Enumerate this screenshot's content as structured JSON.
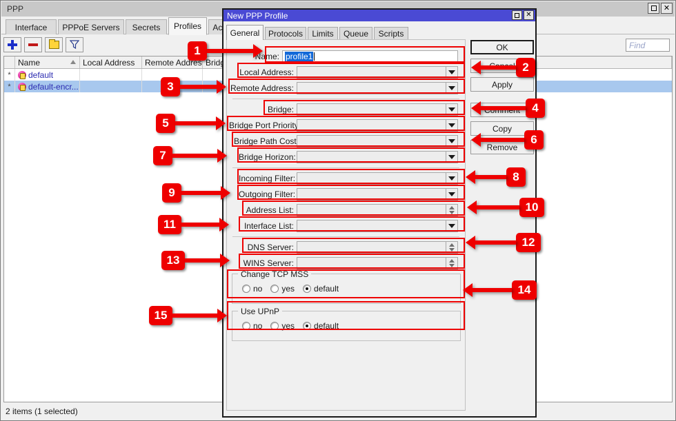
{
  "main_window": {
    "title": "PPP",
    "window_controls": [
      {
        "name": "restore-button",
        "glyph": "□"
      },
      {
        "name": "close-button",
        "glyph": "✕"
      }
    ],
    "tabs": [
      {
        "label": "Interface",
        "active": false
      },
      {
        "label": "PPPoE Servers",
        "active": false
      },
      {
        "label": "Secrets",
        "active": false
      },
      {
        "label": "Profiles",
        "active": true
      },
      {
        "label": "Active Connec",
        "active": false
      }
    ],
    "toolbar": [
      {
        "name": "add-button",
        "icon": "plus-icon"
      },
      {
        "name": "remove-button",
        "icon": "minus-icon"
      },
      {
        "name": "enable-button",
        "icon": "folder-icon"
      },
      {
        "name": "filter-button",
        "icon": "funnel-icon"
      }
    ],
    "find": {
      "placeholder": "Find",
      "value": ""
    },
    "list": {
      "columns": [
        "Name",
        "Local Address",
        "Remote Address",
        "Bridge"
      ],
      "sort_column": "Name",
      "rows": [
        {
          "flag": "*",
          "name": "default",
          "local_address": "",
          "remote_address": "",
          "bridge": "",
          "selected": false
        },
        {
          "flag": "*",
          "name": "default-encr...",
          "local_address": "",
          "remote_address": "",
          "bridge": "",
          "selected": true
        }
      ]
    },
    "status": "2 items (1 selected)"
  },
  "dialog": {
    "title": "New PPP Profile",
    "window_controls": [
      {
        "name": "restore-button",
        "glyph": "□"
      },
      {
        "name": "close-button",
        "glyph": "✕"
      }
    ],
    "tabs": [
      {
        "label": "General",
        "active": true
      },
      {
        "label": "Protocols",
        "active": false
      },
      {
        "label": "Limits",
        "active": false
      },
      {
        "label": "Queue",
        "active": false
      },
      {
        "label": "Scripts",
        "active": false
      }
    ],
    "fields": [
      {
        "label": "Name:",
        "value": "profile1",
        "control": "text",
        "selected": true
      },
      {
        "label": "Local Address:",
        "value": "",
        "control": "dropdown"
      },
      {
        "label": "Remote Address:",
        "value": "",
        "control": "dropdown"
      },
      {
        "label": "Bridge:",
        "value": "",
        "control": "dropdown"
      },
      {
        "label": "Bridge Port Priority:",
        "value": "",
        "control": "dropdown"
      },
      {
        "label": "Bridge Path Cost:",
        "value": "",
        "control": "dropdown"
      },
      {
        "label": "Bridge Horizon:",
        "value": "",
        "control": "dropdown"
      },
      {
        "label": "Incoming Filter:",
        "value": "",
        "control": "dropdown"
      },
      {
        "label": "Outgoing Filter:",
        "value": "",
        "control": "dropdown"
      },
      {
        "label": "Address List:",
        "value": "",
        "control": "spinner"
      },
      {
        "label": "Interface List:",
        "value": "",
        "control": "dropdown"
      },
      {
        "label": "DNS Server:",
        "value": "",
        "control": "spinner"
      },
      {
        "label": "WINS Server:",
        "value": "",
        "control": "spinner"
      }
    ],
    "groups": [
      {
        "legend": "Change TCP MSS",
        "options": [
          {
            "label": "no",
            "checked": false
          },
          {
            "label": "yes",
            "checked": false
          },
          {
            "label": "default",
            "checked": true
          }
        ]
      },
      {
        "legend": "Use UPnP",
        "options": [
          {
            "label": "no",
            "checked": false
          },
          {
            "label": "yes",
            "checked": false
          },
          {
            "label": "default",
            "checked": true
          }
        ]
      }
    ],
    "buttons": [
      {
        "label": "OK",
        "primary": true
      },
      {
        "label": "Cancel",
        "primary": false
      },
      {
        "label": "Apply",
        "primary": false
      },
      {
        "label": "Comment",
        "primary": false
      },
      {
        "label": "Copy",
        "primary": false
      },
      {
        "label": "Remove",
        "primary": false
      }
    ]
  },
  "annotations": {
    "accent_color": "#ee0000",
    "callouts": [
      {
        "number": "1",
        "target": "Name:"
      },
      {
        "number": "2",
        "target": "Local Address:"
      },
      {
        "number": "3",
        "target": "Remote Address:"
      },
      {
        "number": "4",
        "target": "Bridge:"
      },
      {
        "number": "5",
        "target": "Bridge Port Priority:"
      },
      {
        "number": "6",
        "target": "Bridge Path Cost:"
      },
      {
        "number": "7",
        "target": "Bridge Horizon:"
      },
      {
        "number": "8",
        "target": "Incoming Filter:"
      },
      {
        "number": "9",
        "target": "Outgoing Filter:"
      },
      {
        "number": "10",
        "target": "Address List:"
      },
      {
        "number": "11",
        "target": "Interface List:"
      },
      {
        "number": "12",
        "target": "DNS Server:"
      },
      {
        "number": "13",
        "target": "WINS Server:"
      },
      {
        "number": "14",
        "target": "Change TCP MSS"
      },
      {
        "number": "15",
        "target": "Use UPnP"
      }
    ]
  }
}
